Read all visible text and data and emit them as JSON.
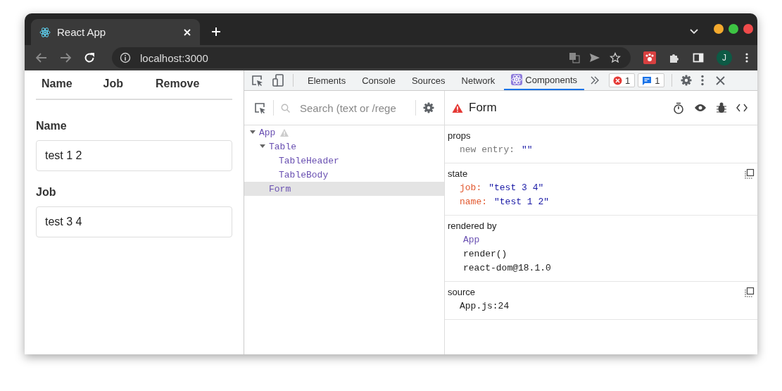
{
  "browser": {
    "tabs": [
      {
        "title": "React App",
        "selected": true
      }
    ],
    "address": "localhost:3000",
    "profile_initial": "J"
  },
  "page": {
    "table_headers": [
      "Name",
      "Job",
      "Remove"
    ],
    "fields": [
      {
        "label": "Name",
        "value": "test 1 2"
      },
      {
        "label": "Job",
        "value": "test 3 4"
      }
    ]
  },
  "devtools": {
    "tabs": [
      {
        "label": "Elements",
        "selected": false
      },
      {
        "label": "Console",
        "selected": false
      },
      {
        "label": "Sources",
        "selected": false
      },
      {
        "label": "Network",
        "selected": false
      },
      {
        "label": "Components",
        "selected": true
      }
    ],
    "error_count": "1",
    "message_count": "1",
    "components": {
      "search": {
        "placeholder": "Search (text or /rege"
      },
      "tree": [
        {
          "name": "App",
          "warning": true,
          "expanded": true,
          "selected": false,
          "children": [
            {
              "name": "Table",
              "warning": false,
              "expanded": true,
              "selected": false,
              "children": [
                {
                  "name": "TableHeader",
                  "warning": false,
                  "selected": false
                },
                {
                  "name": "TableBody",
                  "warning": false,
                  "selected": false
                }
              ]
            },
            {
              "name": "Form",
              "warning": false,
              "selected": true
            }
          ]
        }
      ],
      "inspector": {
        "title": "Form",
        "warning": true,
        "sections": [
          {
            "title": "props",
            "kind": "props",
            "copyable": false,
            "entries": [
              {
                "key": "new entry:",
                "value": "\"\""
              }
            ]
          },
          {
            "title": "state",
            "kind": "state",
            "copyable": true,
            "entries": [
              {
                "key": "job:",
                "value": "\"test 3 4\""
              },
              {
                "key": "name:",
                "value": "\"test 1 2\""
              }
            ]
          },
          {
            "title": "rendered by",
            "kind": "list",
            "copyable": false,
            "items": [
              {
                "text": "App",
                "kind": "component"
              },
              {
                "text": "render()",
                "kind": "plain"
              },
              {
                "text": "react-dom@18.1.0",
                "kind": "plain"
              }
            ]
          },
          {
            "title": "source",
            "kind": "list",
            "copyable": true,
            "items": [
              {
                "text": "App.js:24",
                "kind": "plain"
              }
            ]
          }
        ]
      }
    }
  }
}
